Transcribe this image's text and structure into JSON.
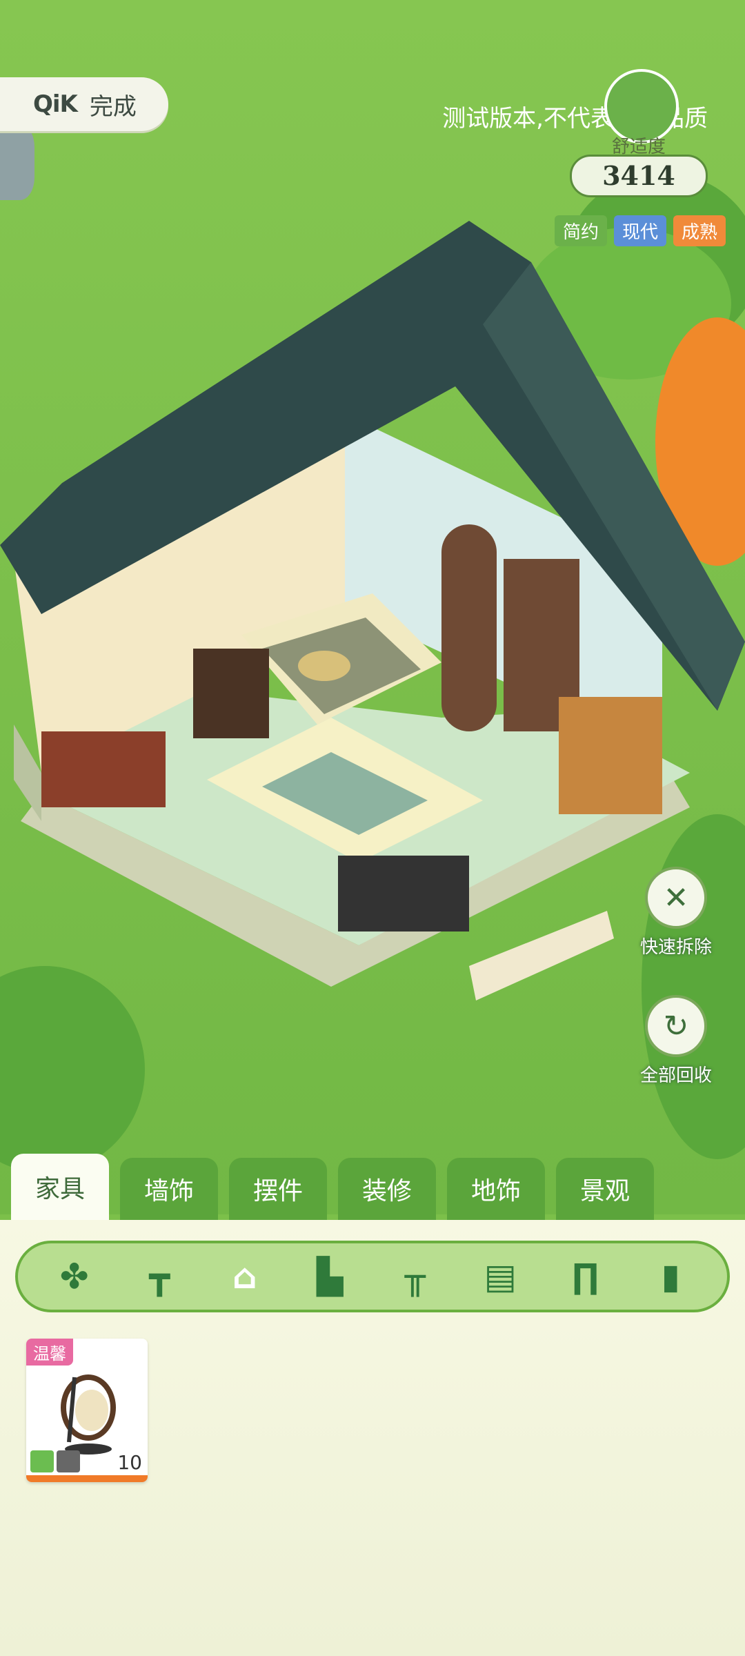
{
  "top_bar": {
    "logo_text": "QiK",
    "done_label": "完成",
    "watermark": "测试版本,不代表最终品质"
  },
  "comfort": {
    "label": "舒适度",
    "value": "3414"
  },
  "style_tags": [
    {
      "label": "简约",
      "color": "#6bb14a"
    },
    {
      "label": "现代",
      "color": "#5b8fd8"
    },
    {
      "label": "成熟",
      "color": "#f08a3a"
    }
  ],
  "side_actions": {
    "quick_remove": "快速拆除",
    "recall_all": "全部回收"
  },
  "tabs": [
    {
      "label": "家具",
      "active": true
    },
    {
      "label": "墙饰",
      "active": false
    },
    {
      "label": "摆件",
      "active": false
    },
    {
      "label": "装修",
      "active": false
    },
    {
      "label": "地饰",
      "active": false
    },
    {
      "label": "景观",
      "active": false
    }
  ],
  "categories": [
    {
      "icon": "clover-icon",
      "active": false
    },
    {
      "icon": "table-icon",
      "active": false
    },
    {
      "icon": "armchair-icon",
      "active": true
    },
    {
      "icon": "bed-icon",
      "active": false
    },
    {
      "icon": "desk-icon",
      "active": false
    },
    {
      "icon": "cabinet-icon",
      "active": false
    },
    {
      "icon": "wardrobe-icon",
      "active": false
    },
    {
      "icon": "screen-icon",
      "active": false
    }
  ],
  "items": [
    {
      "tag": "温馨",
      "count": "10",
      "icon": "hanging-egg-chair-icon"
    }
  ],
  "colors": {
    "grass": "#7cc04a",
    "tab_green": "#5ba53b",
    "panel": "#f7f8e3",
    "roof": "#2f4a4a"
  }
}
